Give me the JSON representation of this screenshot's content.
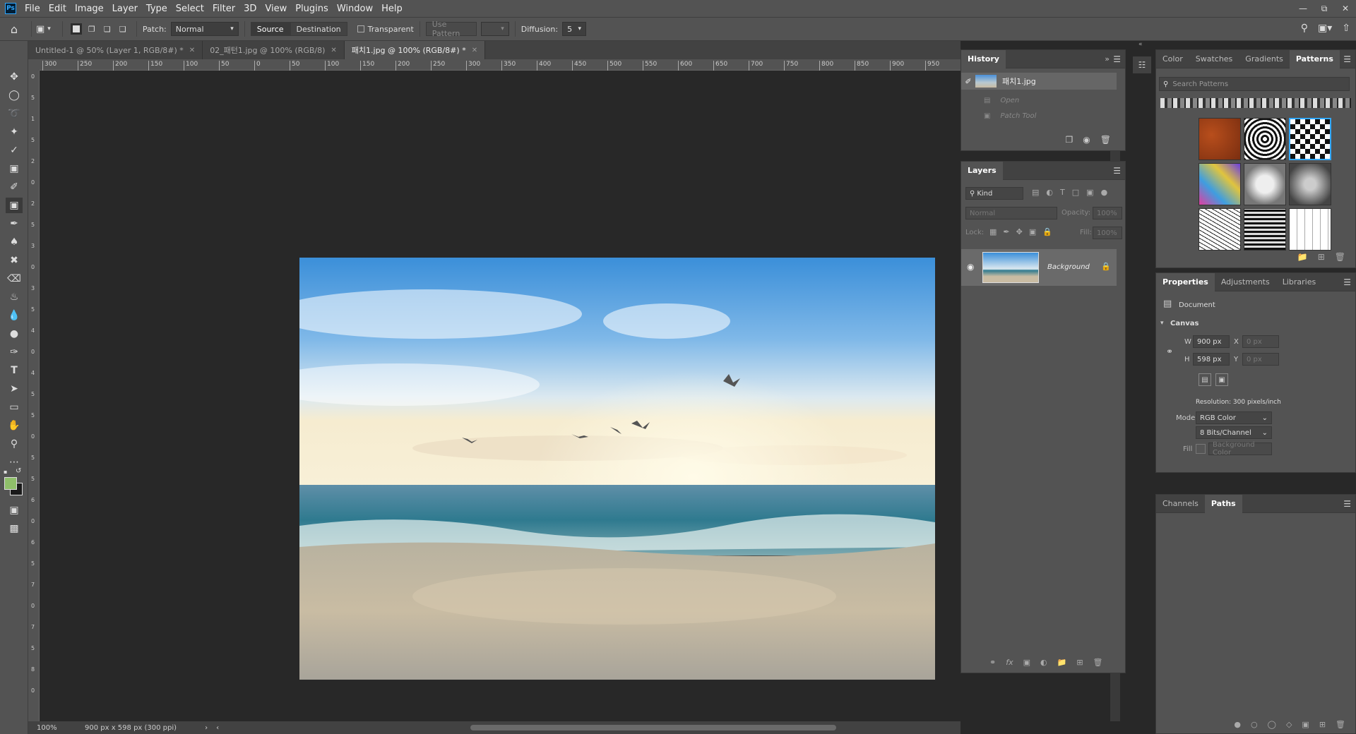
{
  "menu": {
    "logo": "Ps",
    "items": [
      "File",
      "Edit",
      "Image",
      "Layer",
      "Type",
      "Select",
      "Filter",
      "3D",
      "View",
      "Plugins",
      "Window",
      "Help"
    ]
  },
  "options": {
    "patch_label": "Patch:",
    "patch_value": "Normal",
    "source": "Source",
    "destination": "Destination",
    "transparent": "Transparent",
    "use_pattern": "Use Pattern",
    "diffusion_label": "Diffusion:",
    "diffusion_value": "5"
  },
  "tabs": [
    {
      "label": "Untitled-1 @ 50% (Layer 1, RGB/8#) *",
      "active": false
    },
    {
      "label": "02_패턴1.jpg @ 100% (RGB/8)",
      "active": false
    },
    {
      "label": "패치1.jpg @ 100% (RGB/8#) *",
      "active": true
    }
  ],
  "ruler_h": [
    "300",
    "250",
    "200",
    "150",
    "100",
    "50",
    "0",
    "50",
    "100",
    "150",
    "200",
    "250",
    "300",
    "350",
    "400",
    "450",
    "500",
    "550",
    "600",
    "650",
    "700",
    "750",
    "800",
    "850",
    "900",
    "950"
  ],
  "ruler_v": [
    "0",
    "5",
    "1",
    "5",
    "2",
    "0",
    "2",
    "5",
    "3",
    "0",
    "3",
    "5",
    "4",
    "0",
    "4",
    "5",
    "5",
    "0",
    "5",
    "5",
    "6",
    "0",
    "6",
    "5",
    "7",
    "0",
    "7",
    "5",
    "8",
    "0"
  ],
  "status": {
    "zoom": "100%",
    "info": "900 px x 598 px (300 ppi)"
  },
  "history": {
    "title": "History",
    "snapshot": "패치1.jpg",
    "items": [
      "Open",
      "Patch Tool"
    ]
  },
  "layers": {
    "title": "Layers",
    "kind": "Kind",
    "blend": "Normal",
    "opacity_label": "Opacity:",
    "opacity_value": "100%",
    "lock_label": "Lock:",
    "fill_label": "Fill:",
    "fill_value": "100%",
    "layer_name": "Background"
  },
  "patterns_panel": {
    "tabs": [
      "Color",
      "Swatches",
      "Gradients",
      "Patterns"
    ],
    "active": "Patterns",
    "search_placeholder": "Search Patterns"
  },
  "properties": {
    "tabs": [
      "Properties",
      "Adjustments",
      "Libraries"
    ],
    "doc_label": "Document",
    "canvas_label": "Canvas",
    "w_label": "W",
    "w_value": "900 px",
    "h_label": "H",
    "h_value": "598 px",
    "x_label": "X",
    "x_value": "0 px",
    "y_label": "Y",
    "y_value": "0 px",
    "resolution": "Resolution: 300 pixels/inch",
    "mode_label": "Mode",
    "mode_value": "RGB Color",
    "bits_value": "8 Bits/Channel",
    "fill_label": "Fill",
    "fill_value": "Background Color"
  },
  "paths_panel": {
    "tabs": [
      "Channels",
      "Paths"
    ],
    "active": "Paths"
  },
  "colors": {
    "fg": "#8fbf6a",
    "bg": "#1a1a1a",
    "accent": "#31a8ff"
  }
}
